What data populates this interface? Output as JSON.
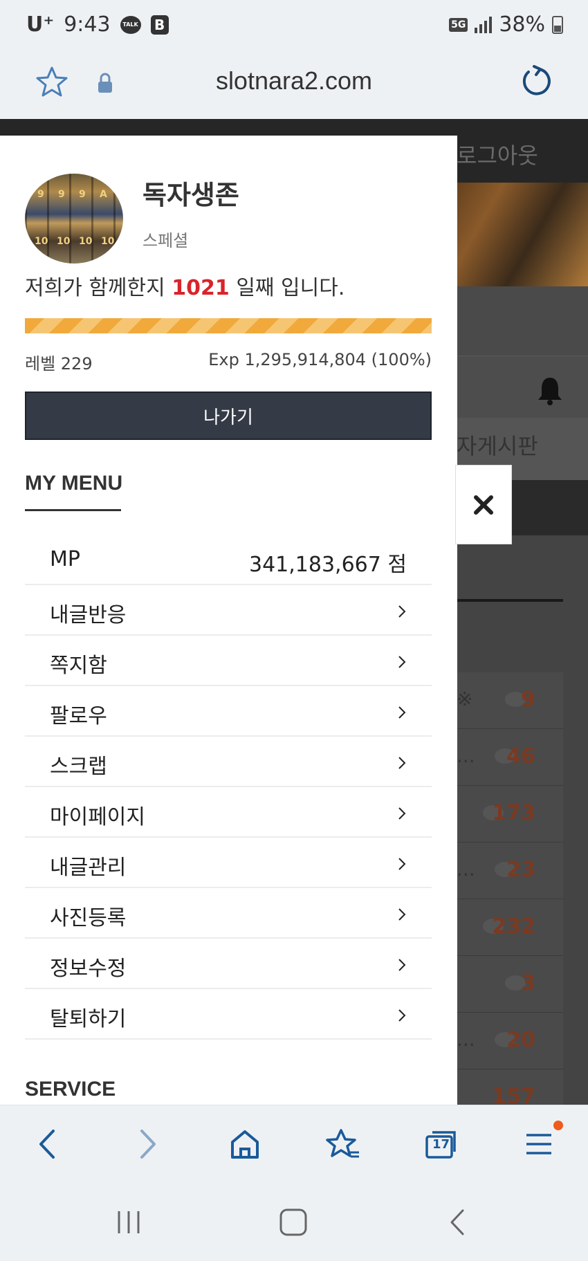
{
  "status_bar": {
    "carrier": "U⁺",
    "time": "9:43",
    "talk_badge": "TALK",
    "b_badge": "B",
    "network": "5G",
    "battery": "38%"
  },
  "url_bar": {
    "url": "slotnara2.com",
    "icons": [
      "star-icon",
      "lock-icon",
      "reload-icon"
    ]
  },
  "behind_page": {
    "logout": "로그아웃",
    "board": "자게시판",
    "rows": [
      {
        "prefix": "※",
        "count": "9"
      },
      {
        "prefix": "...",
        "count": "46"
      },
      {
        "prefix": "",
        "count": "173"
      },
      {
        "prefix": "...",
        "count": "23"
      },
      {
        "prefix": "",
        "count": "232"
      },
      {
        "prefix": "",
        "count": "3"
      },
      {
        "prefix": "...",
        "count": "20"
      },
      {
        "prefix": "",
        "count": "157"
      }
    ]
  },
  "profile": {
    "nickname": "독자생존",
    "grade": "스페셜",
    "together_prefix": "저희가 함께한지 ",
    "together_days": "1021",
    "together_suffix": " 일째 입니다.",
    "exp_progress": 1.0,
    "level": "레벨 229",
    "exp": "Exp 1,295,914,804 (100%)",
    "exit_label": "나가기"
  },
  "my_menu": {
    "title": "MY MENU",
    "mp": {
      "label": "MP",
      "value": "341,183,667 점"
    },
    "items": [
      {
        "label": "내글반응"
      },
      {
        "label": "쪽지함"
      },
      {
        "label": "팔로우"
      },
      {
        "label": "스크랩"
      },
      {
        "label": "마이페이지"
      },
      {
        "label": "내글관리"
      },
      {
        "label": "사진등록"
      },
      {
        "label": "정보수정"
      },
      {
        "label": "탈퇴하기"
      }
    ]
  },
  "service": {
    "title": "SERVICE"
  },
  "browser_nav": {
    "tabs_count": "17",
    "icons": [
      "back-icon",
      "forward-icon",
      "home-icon",
      "bookmarks-icon",
      "tabs-icon",
      "menu-icon"
    ]
  },
  "colors": {
    "accent_red": "#d8242a",
    "exp_bar": "#f0a93a",
    "button_dark": "#343b46",
    "browser_blue": "#1a5a9a",
    "notification_dot": "#f05a1a"
  }
}
